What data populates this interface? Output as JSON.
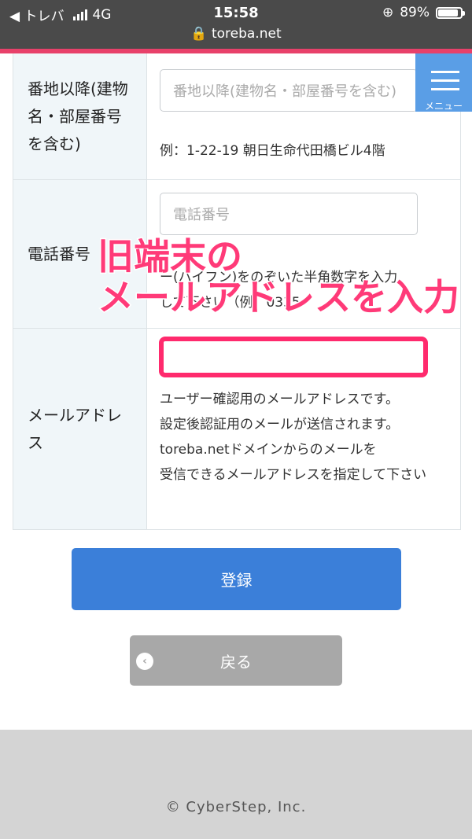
{
  "status_bar": {
    "carrier": "◀ トレバ",
    "network": "4G",
    "time": "15:58",
    "battery": "89%",
    "battery_level": 0.89,
    "url": "toreba.net"
  },
  "menu": {
    "label": "メニュー"
  },
  "form": {
    "address2": {
      "label": "番地以降(建物名・部屋番号を含む)",
      "placeholder": "番地以降(建物名・部屋番号を含む)",
      "example": "例：1-22-19 朝日生命代田橋ビル4階"
    },
    "phone": {
      "label": "電話番号",
      "placeholder": "電話番号",
      "hint_line1": "ー(ハイフン)をのぞいた半角数字を入力",
      "hint_line2": "して下さい（例：0335"
    },
    "email": {
      "label": "メールアドレス",
      "description": [
        "ユーザー確認用のメールアドレスです。",
        "設定後認証用のメールが送信されます。",
        "toreba.netドメインからのメールを",
        "受信できるメールアドレスを指定して下さい"
      ]
    }
  },
  "overlay": {
    "line1": "旧端末の",
    "line2": "メールアドレスを入力"
  },
  "buttons": {
    "submit": "登録",
    "back": "戻る"
  },
  "footer": {
    "copyright": "© CyberStep, Inc."
  },
  "colors": {
    "accent_pink": "#e8416a",
    "submit_blue": "#3b7fd9",
    "menu_blue": "#5a9ee6",
    "overlay_pink": "#ff3a78"
  }
}
